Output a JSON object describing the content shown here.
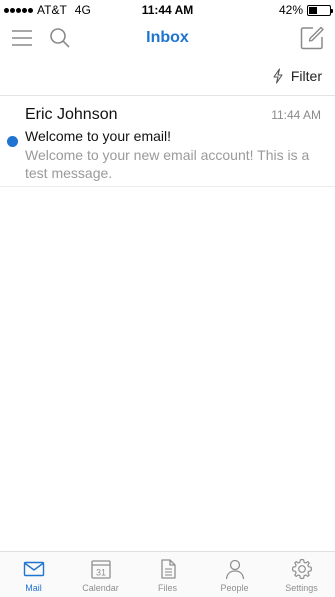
{
  "status_bar": {
    "carrier": "AT&T",
    "network": "4G",
    "time": "11:44 AM",
    "battery_percent": "42%",
    "battery_level": 0.42
  },
  "header": {
    "title": "Inbox",
    "menu_icon": "hamburger-menu-icon",
    "search_icon": "search-icon",
    "compose_icon": "compose-icon",
    "accent_color": "#1e74d0"
  },
  "filter": {
    "label": "Filter",
    "icon": "lightning-icon"
  },
  "messages": [
    {
      "sender": "Eric Johnson",
      "time": "11:44 AM",
      "subject": "Welcome to your email!",
      "preview": "Welcome to your new email account! This is a test message.",
      "unread": true
    }
  ],
  "tabs": [
    {
      "label": "Mail",
      "icon": "mail-icon",
      "active": true
    },
    {
      "label": "Calendar",
      "icon": "calendar-icon",
      "day": "31",
      "active": false
    },
    {
      "label": "Files",
      "icon": "file-icon",
      "active": false
    },
    {
      "label": "People",
      "icon": "person-icon",
      "active": false
    },
    {
      "label": "Settings",
      "icon": "gear-icon",
      "active": false
    }
  ]
}
